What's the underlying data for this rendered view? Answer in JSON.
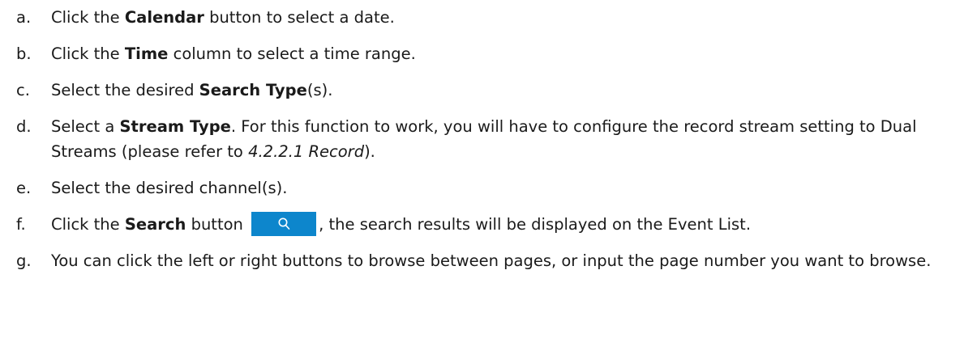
{
  "steps": [
    {
      "marker": "a.",
      "t1": "Click the ",
      "b1": "Calendar",
      "t2": " button to select a date."
    },
    {
      "marker": "b.",
      "t1": "Click the ",
      "b1": "Time",
      "t2": " column to select a time range."
    },
    {
      "marker": "c.",
      "t1": "Select the desired ",
      "b1": "Search Type",
      "t2": "(s)."
    },
    {
      "marker": "d.",
      "t1": "Select a ",
      "b1": "Stream Type",
      "t2": ". For this function to work, you will have to configure the record stream setting to Dual Streams (please refer to ",
      "i1": "4.2.2.1 Record",
      "t3": ")."
    },
    {
      "marker": "e.",
      "t1": "Select the desired channel(s)."
    },
    {
      "marker": "f.",
      "t1": "Click the ",
      "b1": "Search",
      "t2": " button ",
      "t3": ", the search results will be displayed on the Event List."
    },
    {
      "marker": "g.",
      "t1": "You can click the left or right buttons to browse between pages, or input the page number you want to browse."
    }
  ],
  "icons": {
    "search_button_icon": "search-icon",
    "search_button_color": "#0d86cc"
  }
}
